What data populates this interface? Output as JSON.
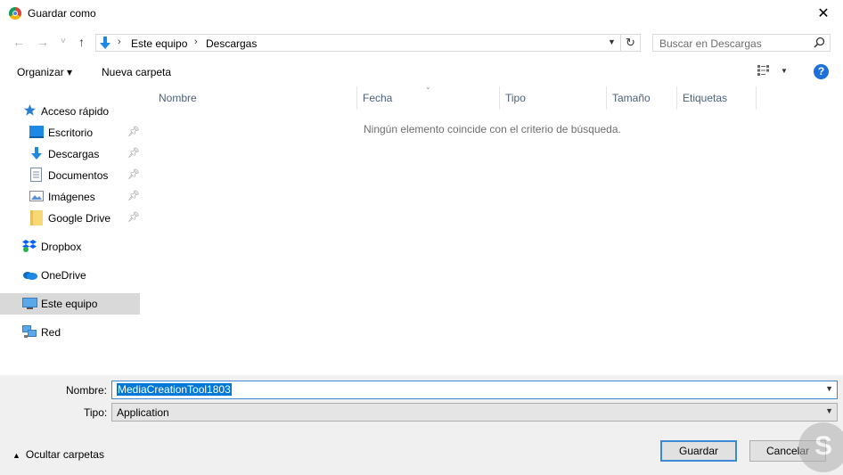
{
  "window": {
    "title": "Guardar como",
    "close": "✕"
  },
  "nav": {
    "back": "←",
    "forward": "→",
    "recent": "˅",
    "up": "↑",
    "breadcrumbs": [
      "Este equipo",
      "Descargas"
    ],
    "refresh": "↻",
    "search_placeholder": "Buscar en Descargas"
  },
  "toolbar": {
    "organize": "Organizar ▾",
    "new_folder": "Nueva carpeta"
  },
  "sidebar": {
    "quick_access": "Acceso rápido",
    "pinned": [
      "Escritorio",
      "Descargas",
      "Documentos",
      "Imágenes",
      "Google Drive"
    ],
    "dropbox": "Dropbox",
    "onedrive": "OneDrive",
    "this_pc": "Este equipo",
    "network": "Red"
  },
  "columns": [
    "Nombre",
    "Fecha",
    "Tipo",
    "Tamaño",
    "Etiquetas"
  ],
  "empty_message": "Ningún elemento coincide con el criterio de búsqueda.",
  "form": {
    "name_label": "Nombre:",
    "name_value": "MediaCreationTool1803",
    "type_label": "Tipo:",
    "type_value": "Application"
  },
  "footer": {
    "hide_folders": "Ocultar carpetas",
    "save": "Guardar",
    "cancel": "Cancelar"
  },
  "watermark": "S",
  "colors": {
    "accent": "#0078d7",
    "selection": "#d9d9d9",
    "help": "#1e6fd9"
  }
}
